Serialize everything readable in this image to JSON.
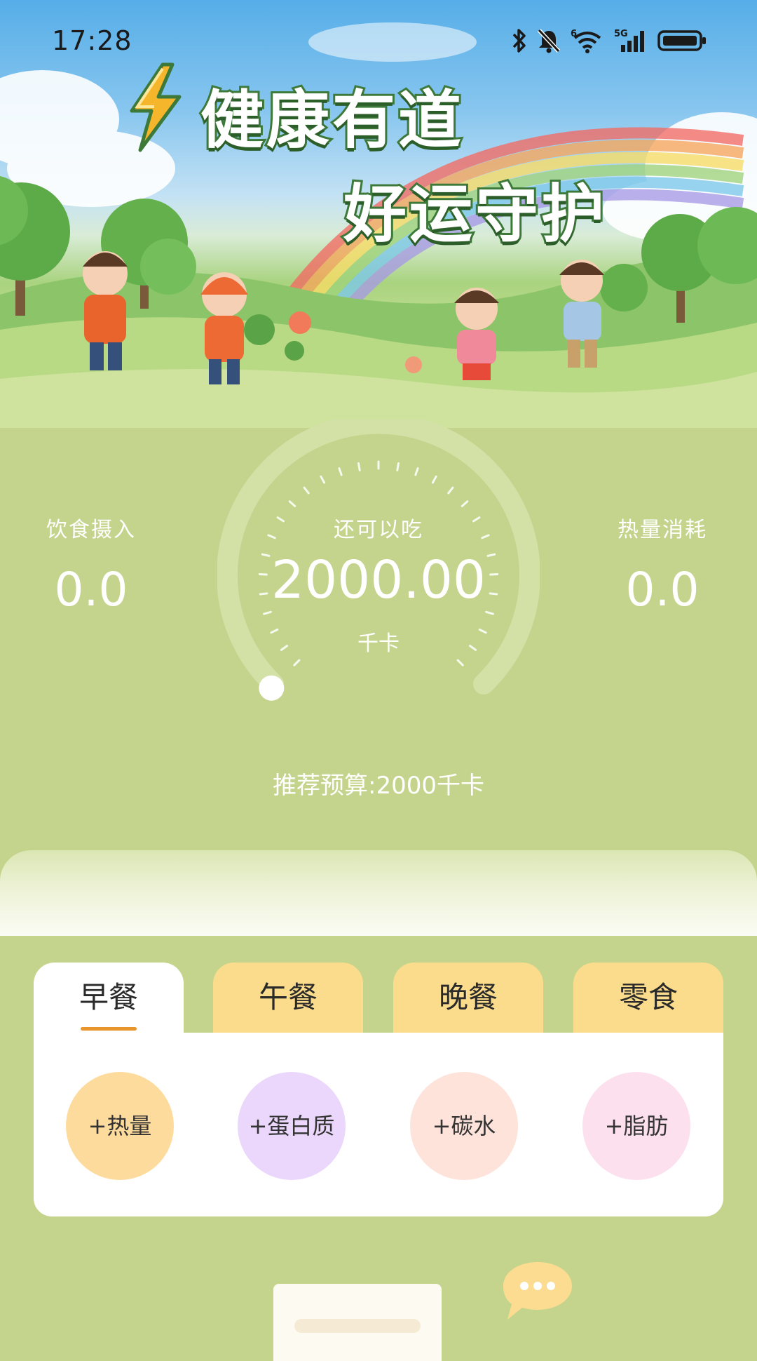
{
  "status_bar": {
    "time": "17:28",
    "icons": [
      "bluetooth-icon",
      "mute-bell-icon",
      "wifi-6-icon",
      "signal-5g-icon",
      "battery-icon"
    ],
    "wifi_badge": "6",
    "network_badge": "5G"
  },
  "banner": {
    "title_line1": "健康有道",
    "title_line2": "好运守护",
    "icon": "lightning-bolt-icon"
  },
  "calories": {
    "intake_label": "饮食摄入",
    "intake_value": "0.0",
    "remaining_label": "还可以吃",
    "remaining_value": "2000.00",
    "remaining_unit": "千卡",
    "burned_label": "热量消耗",
    "burned_value": "0.0",
    "consumed_fraction": 0,
    "budget_text": "推荐预算:2000千卡"
  },
  "meal_tabs": [
    {
      "label": "早餐",
      "active": true
    },
    {
      "label": "午餐",
      "active": false
    },
    {
      "label": "晚餐",
      "active": false
    },
    {
      "label": "零食",
      "active": false
    }
  ],
  "nutrients": [
    {
      "label": "+热量",
      "color": "#fddb9c"
    },
    {
      "label": "+蛋白质",
      "color": "#ead7fb"
    },
    {
      "label": "+碳水",
      "color": "#fde3da"
    },
    {
      "label": "+脂肪",
      "color": "#fce0ee"
    }
  ],
  "fab": {
    "icon": "chat-bubble-icon",
    "color": "#fcdc90"
  },
  "colors": {
    "background": "#c4d48c",
    "tab_inactive": "#fadc8c",
    "tab_underline": "#e8962c",
    "title_outline": "#3d7a3a"
  }
}
